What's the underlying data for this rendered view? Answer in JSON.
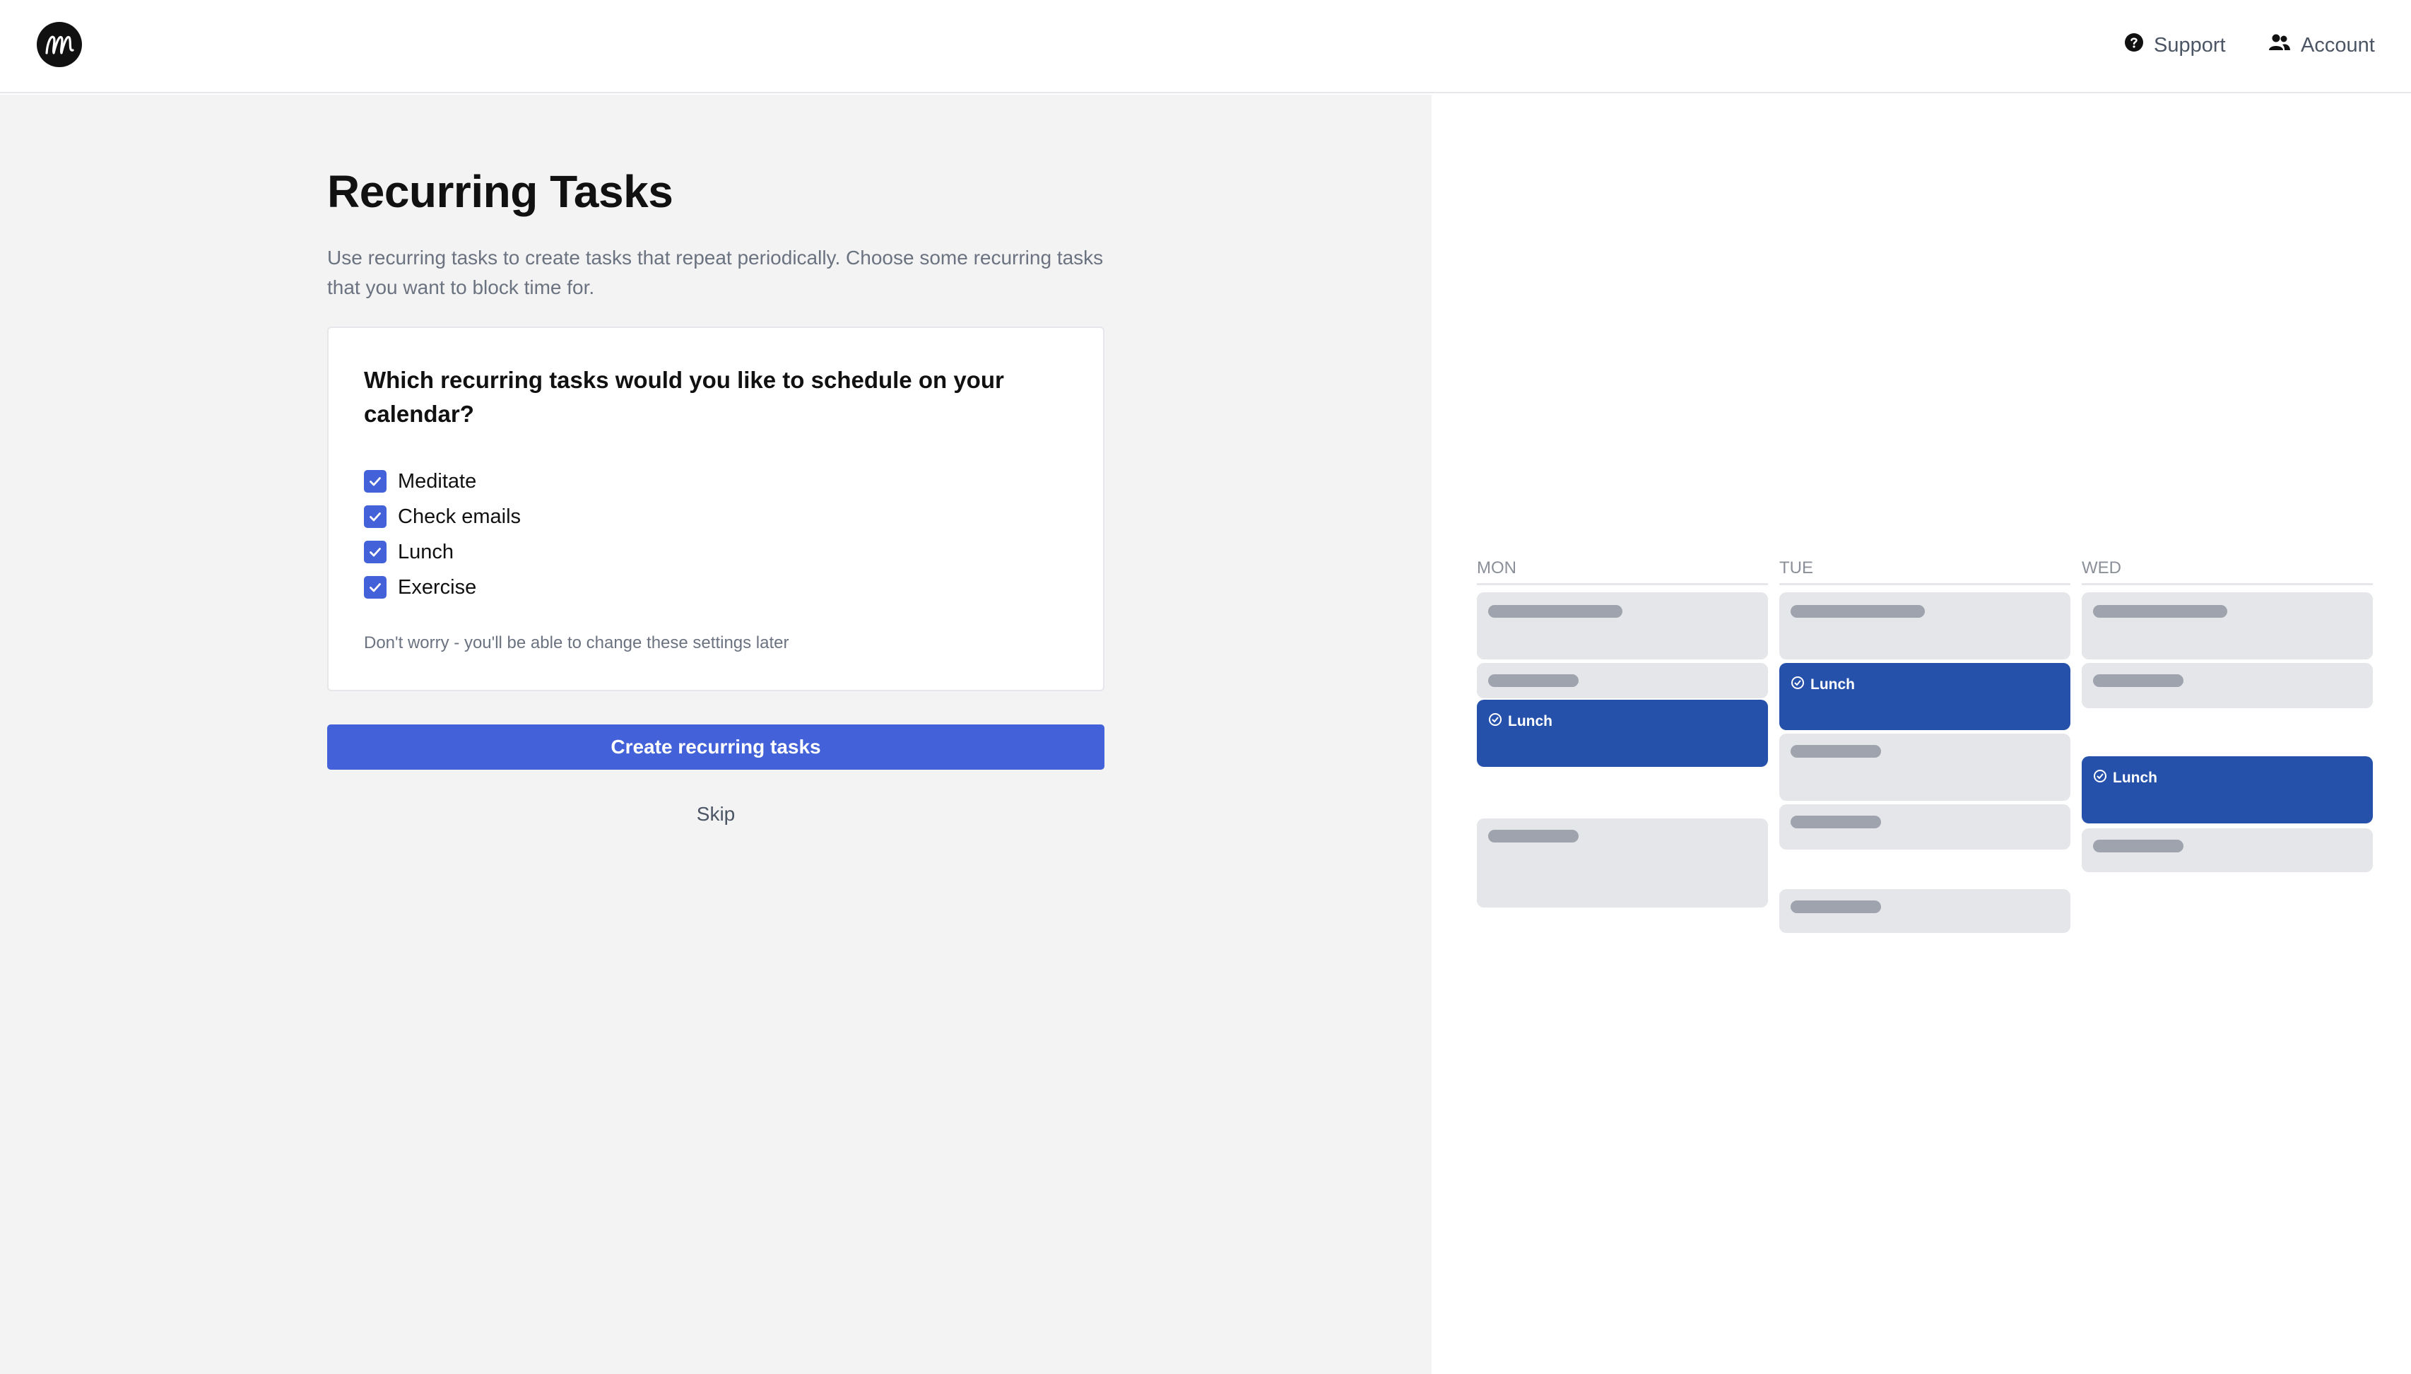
{
  "header": {
    "logo_icon": "script-m-logo",
    "support_label": "Support",
    "account_label": "Account"
  },
  "main": {
    "title": "Recurring Tasks",
    "description": "Use recurring tasks to create tasks that repeat periodically. Choose some recurring tasks that you want to block time for.",
    "card": {
      "question": "Which recurring tasks would you like to schedule on your calendar?",
      "tasks": [
        {
          "label": "Meditate",
          "checked": true
        },
        {
          "label": "Check emails",
          "checked": true
        },
        {
          "label": "Lunch",
          "checked": true
        },
        {
          "label": "Exercise",
          "checked": true
        }
      ],
      "hint": "Don't worry - you'll be able to change these settings later"
    },
    "create_button_label": "Create recurring tasks",
    "skip_label": "Skip"
  },
  "calendar_preview": {
    "days": [
      {
        "label": "MON",
        "event_label": "Lunch"
      },
      {
        "label": "TUE",
        "event_label": "Lunch"
      },
      {
        "label": "WED",
        "event_label": "Lunch"
      }
    ]
  },
  "colors": {
    "accent": "#4361d8",
    "event": "#2651ab",
    "left_background": "#f3f3f3"
  }
}
